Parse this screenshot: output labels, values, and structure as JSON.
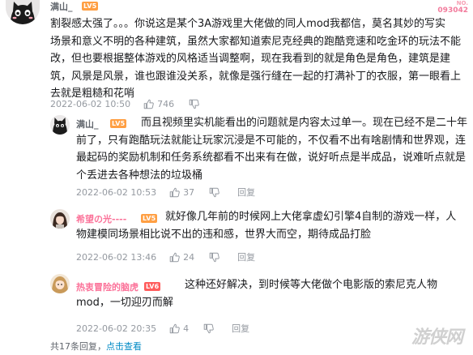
{
  "top": {
    "username": "满山_",
    "level": "LV5",
    "badge_line1": "NO.",
    "badge_line2": "093042"
  },
  "main_comment": {
    "text_lines": [
      "割裂感太强了。。。你说这是某个3A游戏里大佬做的同人mod我都信，莫名其妙的写实",
      "场景和意义不明的各种建筑，虽然大家都知道索尼克经典的跑酷竞速和吃金环的玩法不能",
      "改，但也要根据整体游戏的风格适当调整啊，现在我看到的就是角色是角色，建筑是建",
      "筑，风景是风景，谁也跟谁没关系，就像是强行缝在一起的打满补丁的衣服，第一眼看上",
      "去就是粗糙和花哨"
    ],
    "time": "2022-06-02 10:50",
    "likes": "746"
  },
  "replies": [
    {
      "username": "满山_",
      "level": "LV5",
      "text_lines": [
        "而且视频里实机能看出的问题就是内容太过单一。现在已经不是二十年",
        "前了，只有跑酷玩法就能让玩家沉浸是不可能的，不仅看不出有啥剧情和世界观，连",
        "最起码的奖励机制和任务系统都看不出来有在做，说好听点是半成品，说难听点就是",
        "个丢进去各种想法的垃圾桶"
      ],
      "time": "2022-06-02 10:53",
      "likes": "37",
      "reply": "回复"
    },
    {
      "username": "希望の光----",
      "level": "LV5",
      "text_lines": [
        "就好像几年前的时候网上大佬拿虚幻引擎4自制的游戏一样，人",
        "物建模同场景相比说不出的违和感，世界大而空，期待成品打脸"
      ],
      "time": "2022-06-02 13:46",
      "likes": "24",
      "reply": "回复"
    },
    {
      "username": "热衷冒险的脑虎",
      "level": "LV6",
      "text_lines": [
        "这种还好解决，到时候等大佬做个电影版的索尼克人物",
        "mod，一切迎刃而解"
      ],
      "time": "2022-06-02 20:35",
      "likes": "4",
      "reply": "回复"
    }
  ],
  "footer": {
    "summary": "共17条回复，",
    "action": "点击查看"
  },
  "watermark": "游侠网",
  "colors": {
    "pink_name": "#fb7299",
    "lv5": "#ff9f43",
    "lv6": "#ff5c5c",
    "meta": "#9499a0",
    "link": "#008ac5"
  },
  "icons": {
    "like": "thumb-up-icon",
    "dislike": "thumb-down-icon"
  }
}
